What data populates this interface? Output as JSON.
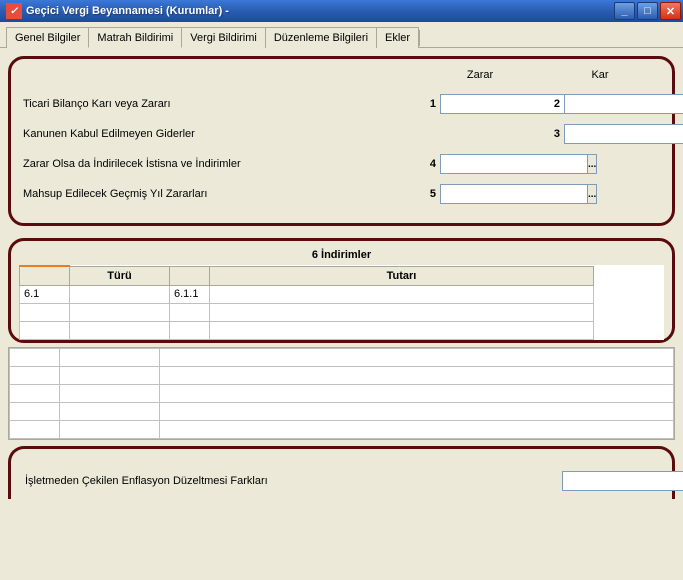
{
  "window": {
    "title": "Geçici Vergi Beyannamesi (Kurumlar) -"
  },
  "tabs": {
    "items": [
      "Genel Bilgiler",
      "Matrah Bildirimi",
      "Vergi Bildirimi",
      "Düzenleme Bilgileri",
      "Ekler"
    ],
    "activeIndex": 1
  },
  "panel1": {
    "headers": {
      "zarar": "Zarar",
      "kar": "Kar"
    },
    "rows": [
      {
        "label": "Ticari Bilanço Karı veya Zararı",
        "zararNum": "1",
        "zararVal": "",
        "karNum": "2",
        "karVal": ""
      },
      {
        "label": "Kanunen Kabul Edilmeyen Giderler",
        "zararNum": "",
        "zararVal": "",
        "karNum": "3",
        "karVal": ""
      },
      {
        "label": "Zarar Olsa da İndirilecek İstisna ve İndirimler",
        "zararNum": "4",
        "zararVal": "",
        "karNum": "",
        "karVal": ""
      },
      {
        "label": "Mahsup Edilecek Geçmiş Yıl Zararları",
        "zararNum": "5",
        "zararVal": "",
        "karNum": "",
        "karVal": ""
      }
    ]
  },
  "panel2": {
    "title": "6 İndirimler",
    "cols": {
      "turu": "Türü",
      "tutari": "Tutarı"
    },
    "rows": [
      {
        "num": "6.1",
        "turu": "",
        "sub": "6.1.1",
        "tutar": ""
      }
    ]
  },
  "panel3": {
    "label": "İşletmeden Çekilen Enflasyon Düzeltmesi Farkları",
    "value": ""
  },
  "icons": {
    "ellipsis": "..."
  }
}
